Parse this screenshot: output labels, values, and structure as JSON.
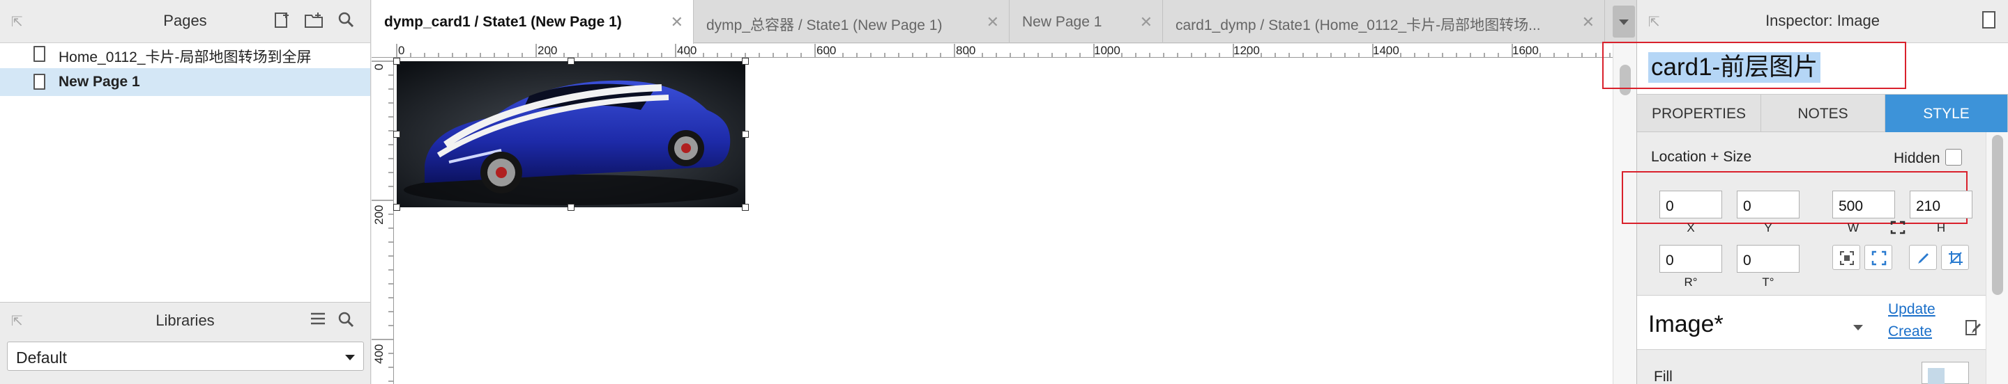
{
  "pages_panel": {
    "title": "Pages",
    "pages": [
      {
        "label": "Home_0112_卡片-局部地图转场到全屏",
        "selected": false
      },
      {
        "label": "New Page 1",
        "selected": true
      }
    ]
  },
  "libraries_panel": {
    "title": "Libraries",
    "selected_library": "Default"
  },
  "tabs": [
    {
      "label": "dymp_card1 / State1 (New Page 1)",
      "active": true
    },
    {
      "label": "dymp_总容器 / State1 (New Page 1)",
      "active": false
    },
    {
      "label": "New Page 1",
      "active": false
    },
    {
      "label": "card1_dymp / State1 (Home_0112_卡片-局部地图转场...",
      "active": false
    }
  ],
  "canvas": {
    "ruler_h_labels": [
      "0",
      "200",
      "400",
      "600",
      "800",
      "1000",
      "1200",
      "1400",
      "1600"
    ],
    "ruler_v_labels": [
      "0",
      "200",
      "400"
    ],
    "selected_image_name": "card1-前层图片"
  },
  "inspector": {
    "title": "Inspector: Image",
    "widget_name": "card1-前层图片",
    "tabs": [
      "PROPERTIES",
      "NOTES",
      "STYLE"
    ],
    "active_tab": "STYLE",
    "location_size_label": "Location + Size",
    "hidden_label": "Hidden",
    "hidden_checked": false,
    "x": "0",
    "y": "0",
    "w": "500",
    "h": "210",
    "x_label": "X",
    "y_label": "Y",
    "w_label": "W",
    "h_label": "H",
    "r": "0",
    "t": "0",
    "r_label": "R°",
    "t_label": "T°",
    "image_type": "Image*",
    "update_link": "Update",
    "create_link": "Create",
    "fill_label": "Fill"
  },
  "colors": {
    "selection": "#d4e7f6",
    "active_tab_blue": "#3d93d9",
    "highlight_red": "#d9212c",
    "text_selection": "#b5d6f6"
  }
}
